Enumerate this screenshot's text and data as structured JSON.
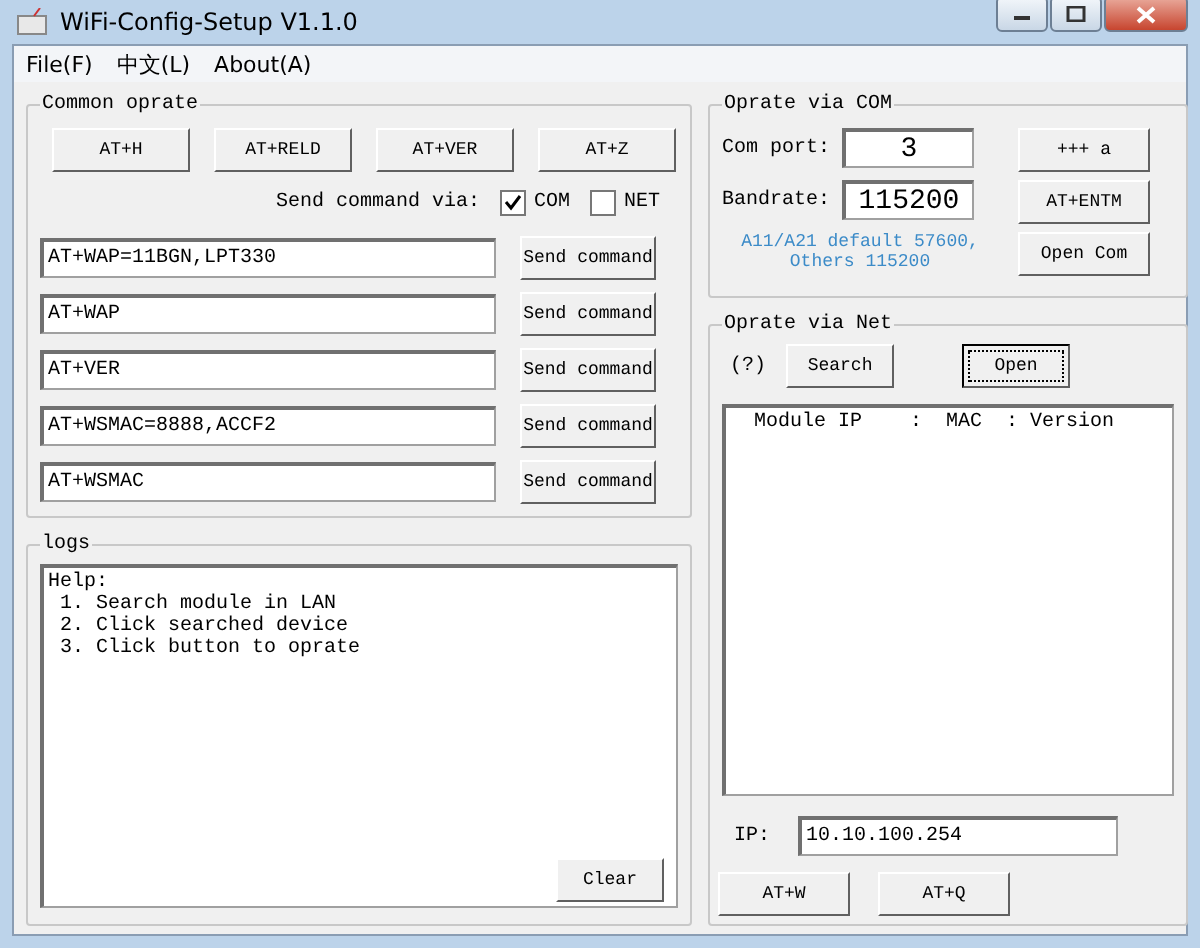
{
  "window": {
    "title": "WiFi-Config-Setup V1.1.0"
  },
  "menu": [
    "File(F)",
    "中文(L)",
    "About(A)"
  ],
  "common": {
    "title": "Common oprate",
    "quick_buttons": [
      "AT+H",
      "AT+RELD",
      "AT+VER",
      "AT+Z"
    ],
    "send_via_label": "Send command via:",
    "send_via": [
      {
        "label": "COM",
        "checked": true
      },
      {
        "label": "NET",
        "checked": false
      }
    ],
    "commands": [
      {
        "value": "AT+WAP=11BGN,LPT330",
        "button": "Send command"
      },
      {
        "value": "AT+WAP",
        "button": "Send command"
      },
      {
        "value": "AT+VER",
        "button": "Send command"
      },
      {
        "value": "AT+WSMAC=8888,ACCF2",
        "button": "Send command"
      },
      {
        "value": "AT+WSMAC",
        "button": "Send command"
      }
    ]
  },
  "logs": {
    "title": "logs",
    "lines": [
      "Help:",
      " 1. Search module in LAN",
      " 2. Click searched device",
      " 3. Click button to oprate"
    ],
    "clear_button": "Clear"
  },
  "com": {
    "title": "Oprate via COM",
    "port_label": "Com port:",
    "port": "3",
    "baud_label": "Bandrate:",
    "baud": "115200",
    "hint_lines": [
      "A11/A21 default 57600,",
      "Others 115200"
    ],
    "buttons": [
      "+++ a",
      "AT+ENTM",
      "Open Com"
    ]
  },
  "net": {
    "title": "Oprate via Net",
    "help": "(?)",
    "search_button": "Search",
    "open_button": {
      "label": "Open",
      "focused": true
    },
    "list_header": "Module IP    :  MAC  : Version",
    "ip_label": "IP:",
    "ip": "10.10.100.254",
    "buttons": [
      "AT+W",
      "AT+Q"
    ]
  }
}
